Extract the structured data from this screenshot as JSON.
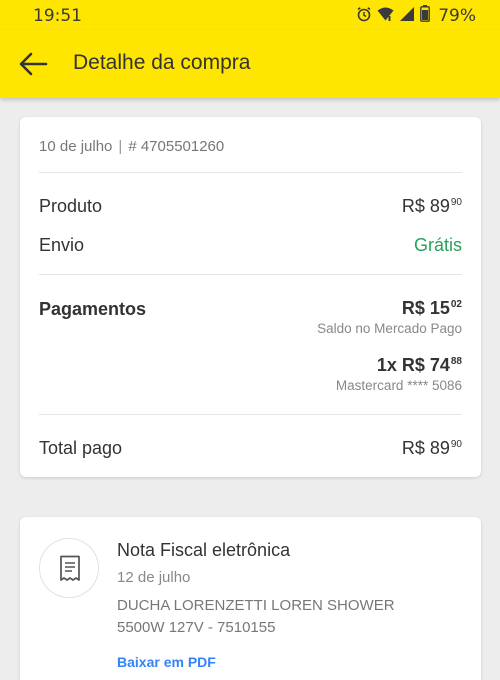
{
  "status_bar": {
    "time": "19:51",
    "battery": "79%",
    "icons": [
      "alarm-icon",
      "wifi-icon",
      "signal-icon",
      "battery-icon"
    ]
  },
  "app_bar": {
    "title": "Detalhe da compra",
    "back_icon": "arrow-left-icon",
    "background": "#ffe600"
  },
  "purchase": {
    "date": "10 de julho",
    "separator": "|",
    "order_number": "# 4705501260",
    "product": {
      "label": "Produto",
      "amount_main": "R$ 89",
      "amount_cents": "90"
    },
    "shipping": {
      "label": "Envio",
      "value": "Grátis",
      "color": "#2aa05a"
    },
    "payments": {
      "label": "Pagamentos",
      "items": [
        {
          "amount_main": "R$ 15",
          "amount_cents": "02",
          "method": "Saldo no Mercado Pago"
        },
        {
          "amount_main": "1x R$ 74",
          "amount_cents": "88",
          "method": "Mastercard **** 5086"
        }
      ]
    },
    "total": {
      "label": "Total pago",
      "amount_main": "R$ 89",
      "amount_cents": "90"
    }
  },
  "invoice": {
    "icon": "receipt-icon",
    "title": "Nota Fiscal eletrônica",
    "date": "12 de julho",
    "description": "DUCHA LORENZETTI LOREN SHOWER 5500W 127V - 7510155",
    "link_label": "Baixar em PDF",
    "link_color": "#3483fa"
  }
}
